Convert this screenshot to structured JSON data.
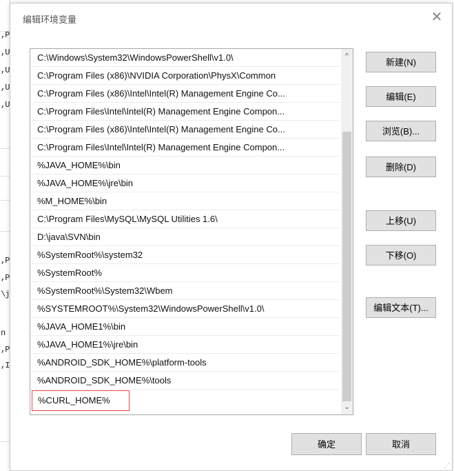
{
  "dialog": {
    "title": "编辑环境变量",
    "close_glyph": "✕"
  },
  "background_fragments": [
    ",P",
    ",U",
    ",U",
    ",U",
    ",U",
    ",P",
    ",P",
    "\\j",
    "n",
    ",P",
    ",I"
  ],
  "path_list": {
    "items": [
      "C:\\Windows\\System32\\WindowsPowerShell\\v1.0\\",
      "C:\\Program Files (x86)\\NVIDIA Corporation\\PhysX\\Common",
      "C:\\Program Files (x86)\\Intel\\Intel(R) Management Engine Co...",
      "C:\\Program Files\\Intel\\Intel(R) Management Engine Compon...",
      "C:\\Program Files (x86)\\Intel\\Intel(R) Management Engine Co...",
      "C:\\Program Files\\Intel\\Intel(R) Management Engine Compon...",
      "%JAVA_HOME%\\bin",
      "%JAVA_HOME%\\jre\\bin",
      "%M_HOME%\\bin",
      "C:\\Program Files\\MySQL\\MySQL Utilities 1.6\\",
      "D:\\java\\SVN\\bin",
      "%SystemRoot%\\system32",
      "%SystemRoot%",
      "%SystemRoot%\\System32\\Wbem",
      "%SYSTEMROOT%\\System32\\WindowsPowerShell\\v1.0\\",
      "%JAVA_HOME1%\\bin",
      "%JAVA_HOME1%\\jre\\bin",
      "%ANDROID_SDK_HOME%\\platform-tools",
      "%ANDROID_SDK_HOME%\\tools"
    ],
    "editing_item": "%CURL_HOME%",
    "scroll_up_glyph": "^",
    "scroll_down_glyph": "⌄"
  },
  "buttons": {
    "new": "新建(N)",
    "edit": "编辑(E)",
    "browse": "浏览(B)...",
    "delete": "删除(D)",
    "move_up": "上移(U)",
    "move_down": "下移(O)",
    "edit_text": "编辑文本(T)...",
    "ok": "确定",
    "cancel": "取消"
  },
  "colors": {
    "highlight_border": "#e54545",
    "button_bg": "#e1e1e1"
  }
}
